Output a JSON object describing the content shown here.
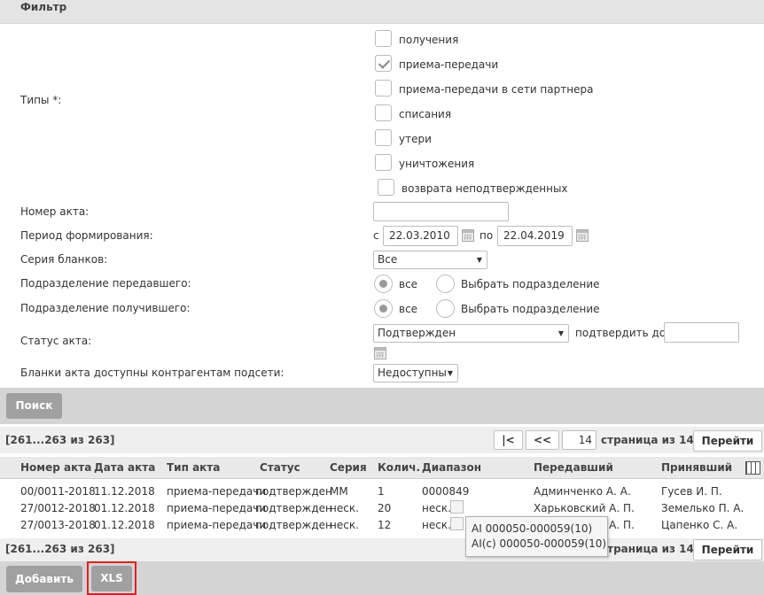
{
  "filter": {
    "title": "Фильтр",
    "types_label": "Типы *:",
    "types": [
      {
        "label": "получения",
        "checked": false
      },
      {
        "label": "приема-передачи",
        "checked": true
      },
      {
        "label": "приема-передачи в сети партнера",
        "checked": false
      },
      {
        "label": "списания",
        "checked": false
      },
      {
        "label": "утери",
        "checked": false
      },
      {
        "label": "уничтожения",
        "checked": false
      },
      {
        "label": "возврата неподтвержденных",
        "checked": false
      }
    ],
    "act_number_label": "Номер акта:",
    "act_number_value": "",
    "period_label": "Период формирования:",
    "period_from_prefix": "с",
    "period_from": "22.03.2010",
    "period_to_prefix": "по",
    "period_to": "22.04.2019",
    "series_label": "Серия бланков:",
    "series_value": "Все",
    "sender_div_label": "Подразделение передавшего:",
    "receiver_div_label": "Подразделение получившего:",
    "radio_all": "все",
    "radio_choose": "Выбрать подразделение",
    "status_label": "Статус акта:",
    "status_value": "Подтвержден",
    "confirm_until_label": "подтвердить до",
    "confirm_until_value": "",
    "blanks_label": "Бланки акта доступны контрагентам подсети:",
    "blanks_value": "Недоступны",
    "search_button": "Поиск"
  },
  "results": {
    "range_text": "[261...263 из 263]",
    "pager": {
      "first": "|<",
      "prev": "<<",
      "page": "14",
      "page_of": "страница из 14",
      "go": "Перейти"
    },
    "columns": [
      "Номер акта",
      "Дата акта",
      "Тип акта",
      "Статус",
      "Серия",
      "Колич.",
      "Диапазон",
      "Передавший",
      "Принявший"
    ],
    "rows": [
      {
        "number": "00/0011-2018",
        "date": "11.12.2018",
        "type": "приема-передачи",
        "status": "подтвержден",
        "series": "MM",
        "count": "1",
        "range": "0000849",
        "sender": "Админченко А. А.",
        "receiver": "Гусев И. П."
      },
      {
        "number": "27/0012-2018",
        "date": "01.12.2018",
        "type": "приема-передачи",
        "status": "подтвержден",
        "series": "неск.",
        "count": "20",
        "range": "неск.",
        "sender": "Харьковский А. П.",
        "receiver": "Земелько П. А."
      },
      {
        "number": "27/0013-2018",
        "date": "01.12.2018",
        "type": "приема-передачи",
        "status": "подтвержден",
        "series": "неск.",
        "count": "12",
        "range": "неск.",
        "sender": "Харьковский А. П.",
        "receiver": "Цапенко С. А."
      }
    ],
    "tooltip_lines": [
      "AI 000050-000059(10)",
      "AI(c) 000050-000059(10)"
    ]
  },
  "footer": {
    "add_button": "Добавить",
    "xls_button": "XLS"
  }
}
